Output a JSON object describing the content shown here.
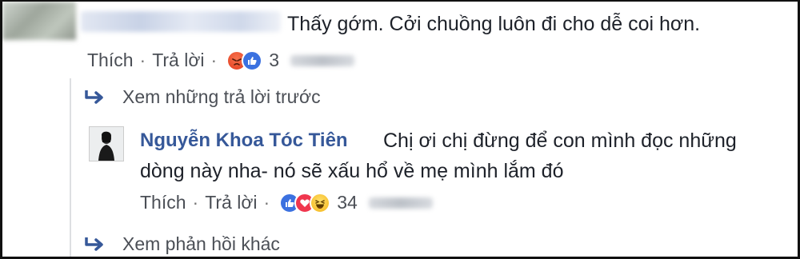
{
  "comment": {
    "text": "Thấy gớm. Cởi chuồng luôn đi cho dễ coi hơn.",
    "like_label": "Thích",
    "reply_label": "Trả lời",
    "separator": "·",
    "reactions": [
      "angry",
      "like"
    ],
    "reaction_count": "3"
  },
  "view_previous_replies": "Xem những trả lời trước",
  "reply": {
    "author": "Nguyễn Khoa Tóc Tiên",
    "text_line1": "Chị ơi chị đừng để con mình đọc những",
    "text_line2": "dòng này nha- nó sẽ xấu hổ về mẹ mình lắm đó",
    "like_label": "Thích",
    "reply_label": "Trả lời",
    "separator": "·",
    "reactions": [
      "like",
      "love",
      "haha"
    ],
    "reaction_count": "34"
  },
  "view_more_replies": "Xem phản hồi khác",
  "colors": {
    "author_link": "#365899",
    "secondary_text": "#4b4f56",
    "arrow": "#365899"
  }
}
